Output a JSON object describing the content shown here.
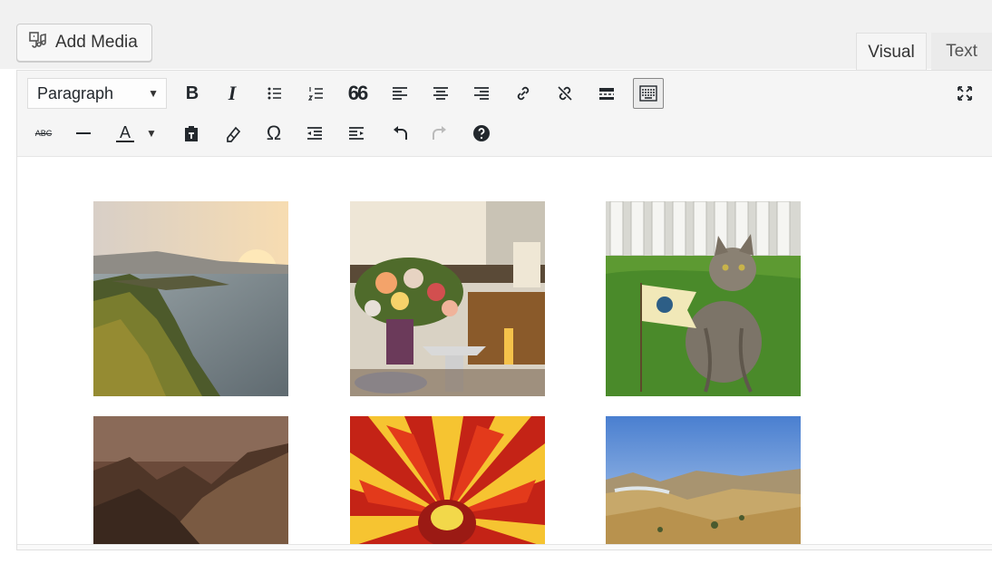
{
  "editor": {
    "add_media_label": "Add Media",
    "tabs": {
      "visual": "Visual",
      "text": "Text"
    },
    "format_select": {
      "value": "Paragraph"
    },
    "toolbar_row1": [
      "bold",
      "italic",
      "bulleted-list",
      "numbered-list",
      "blockquote",
      "align-left",
      "align-center",
      "align-right",
      "insert-link",
      "remove-link",
      "read-more",
      "toolbar-toggle",
      "fullscreen"
    ],
    "toolbar_row2": [
      "strikethrough",
      "horizontal-line",
      "text-color",
      "paste-as-text",
      "clear-formatting",
      "special-character",
      "decrease-indent",
      "increase-indent",
      "undo",
      "redo",
      "keyboard-shortcuts"
    ],
    "glyphs": {
      "bold": "B",
      "italic": "I",
      "blockquote": "66",
      "omega": "Ω",
      "strike": "ABC",
      "text_color": "A"
    },
    "gallery": [
      {
        "subject": "coastal cliffs at sunset"
      },
      {
        "subject": "flower arrangement on a table"
      },
      {
        "subject": "tabby cat in grass with a flag"
      },
      {
        "subject": "brown mountain ridges"
      },
      {
        "subject": "red flower close-up"
      },
      {
        "subject": "golden hills under blue sky"
      }
    ]
  },
  "colors": {
    "chrome_bg": "#f1f1f1",
    "toolbar_bg": "#f5f5f5",
    "icon": "#23282d",
    "border": "#dddddd"
  }
}
